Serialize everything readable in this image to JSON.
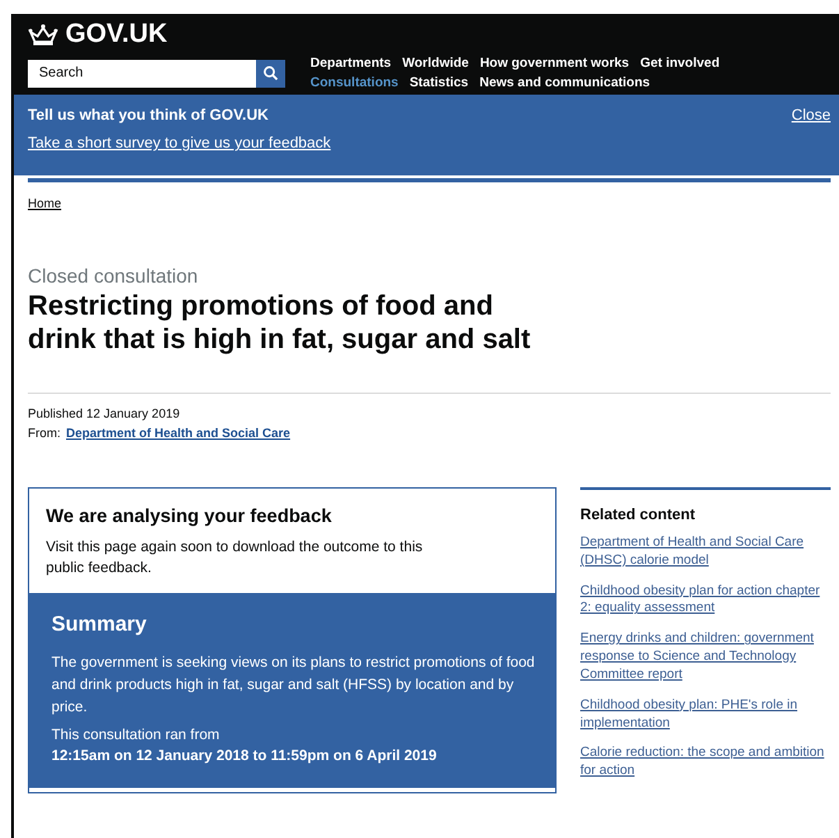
{
  "header": {
    "logo": "GOV.UK",
    "search": {
      "placeholder": "Search"
    },
    "nav": [
      {
        "label": "Departments",
        "selected": false
      },
      {
        "label": "Worldwide",
        "selected": false
      },
      {
        "label": "How government works",
        "selected": false
      },
      {
        "label": "Get involved",
        "selected": false
      },
      {
        "label": "Consultations",
        "selected": true
      },
      {
        "label": "Statistics",
        "selected": false
      },
      {
        "label": "News and communications",
        "selected": false
      }
    ]
  },
  "survey_banner": {
    "title": "Tell us what you think of GOV.UK",
    "link": "Take a short survey to give us your feedback",
    "close": "Close"
  },
  "breadcrumb": [
    "Home"
  ],
  "caption": "Closed consultation",
  "title": "Restricting promotions of food and drink that is high in fat, sugar and salt",
  "published": "Published 12 January 2019",
  "from_label": "From:",
  "from_link": "Department of Health and Social Care",
  "notice": {
    "title": "We are analysing your feedback",
    "text": "Visit this page again soon to download the outcome to this public feedback."
  },
  "summary": {
    "title": "Summary",
    "text": "The government is seeking views on its plans to restrict promotions of food and drink products high in fat, sugar and salt (HFSS) by location and by price.",
    "ran_label": "This consultation ran from",
    "dates": "12:15am on 12 January 2018 to 11:59pm on 6 April 2019"
  },
  "related": {
    "title": "Related content",
    "links": [
      "Department of Health and Social Care (DHSC) calorie model",
      "Childhood obesity plan for action chapter 2: equality assessment",
      "Energy drinks and children: government response to Science and Technology Committee report",
      "Childhood obesity plan: PHE's role in implementation",
      "Calorie reduction: the scope and ambition for action"
    ]
  }
}
